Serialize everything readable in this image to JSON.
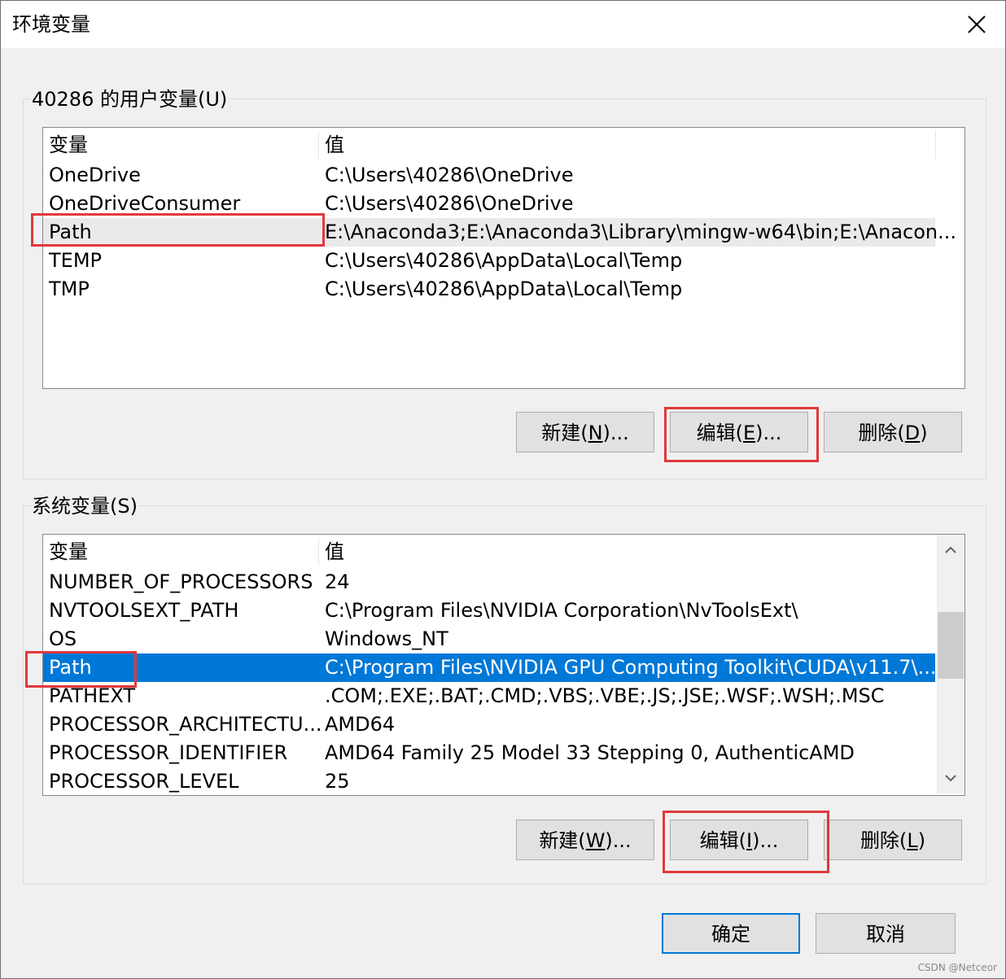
{
  "window": {
    "title": "环境变量",
    "close_symbol": "✕"
  },
  "user_vars": {
    "group_label": "40286 的用户变量(U)",
    "columns": [
      "变量",
      "值"
    ],
    "rows": [
      {
        "name": "OneDrive",
        "value": "C:\\Users\\40286\\OneDrive"
      },
      {
        "name": "OneDriveConsumer",
        "value": "C:\\Users\\40286\\OneDrive"
      },
      {
        "name": "Path",
        "value": "E:\\Anaconda3;E:\\Anaconda3\\Library\\mingw-w64\\bin;E:\\Anacon..."
      },
      {
        "name": "TEMP",
        "value": "C:\\Users\\40286\\AppData\\Local\\Temp"
      },
      {
        "name": "TMP",
        "value": "C:\\Users\\40286\\AppData\\Local\\Temp"
      }
    ],
    "highlighted_row": "Path",
    "buttons": {
      "new": {
        "pre": "新建(",
        "key": "N",
        "post": ")..."
      },
      "edit": {
        "pre": "编辑(",
        "key": "E",
        "post": ")..."
      },
      "delete": {
        "pre": "删除(",
        "key": "D",
        "post": ")"
      }
    }
  },
  "system_vars": {
    "group_label": "系统变量(S)",
    "columns": [
      "变量",
      "值"
    ],
    "rows": [
      {
        "name": "NUMBER_OF_PROCESSORS",
        "value": "24"
      },
      {
        "name": "NVTOOLSEXT_PATH",
        "value": "C:\\Program Files\\NVIDIA Corporation\\NvToolsExt\\"
      },
      {
        "name": "OS",
        "value": "Windows_NT"
      },
      {
        "name": "Path",
        "value": "C:\\Program Files\\NVIDIA GPU Computing Toolkit\\CUDA\\v11.7\\..."
      },
      {
        "name": "PATHEXT",
        "value": ".COM;.EXE;.BAT;.CMD;.VBS;.VBE;.JS;.JSE;.WSF;.WSH;.MSC"
      },
      {
        "name": "PROCESSOR_ARCHITECTU...",
        "value": "AMD64"
      },
      {
        "name": "PROCESSOR_IDENTIFIER",
        "value": "AMD64 Family 25 Model 33 Stepping 0, AuthenticAMD"
      },
      {
        "name": "PROCESSOR_LEVEL",
        "value": "25"
      }
    ],
    "selected_row": "Path",
    "scroll_up_symbol": "^",
    "scroll_down_symbol": "v",
    "buttons": {
      "new": {
        "pre": "新建(",
        "key": "W",
        "post": ")..."
      },
      "edit": {
        "pre": "编辑(",
        "key": "I",
        "post": ")..."
      },
      "delete": {
        "pre": "删除(",
        "key": "L",
        "post": ")"
      }
    }
  },
  "footer": {
    "ok_label": "确定",
    "cancel_label": "取消"
  },
  "watermark": "CSDN @Netceor",
  "colors": {
    "selection": "#0078d7",
    "annotation_red": "#e0393b",
    "light_highlight": "#eaeaea"
  }
}
